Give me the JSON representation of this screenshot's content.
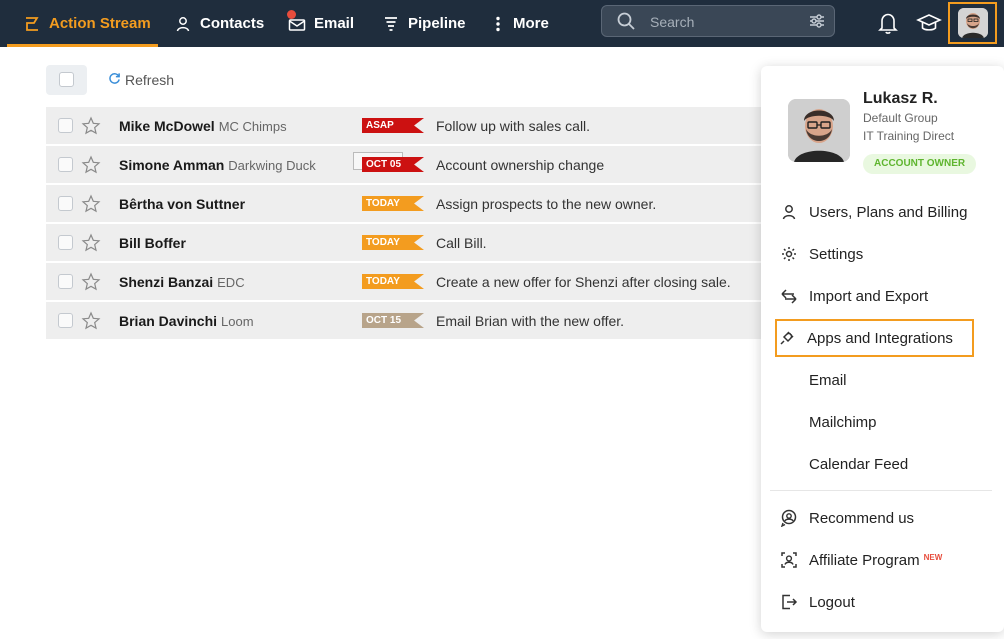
{
  "nav": {
    "items": [
      {
        "label": "Action Stream",
        "icon": "action-stream-icon",
        "active": true
      },
      {
        "label": "Contacts",
        "icon": "user-icon"
      },
      {
        "label": "Email",
        "icon": "envelope-icon"
      },
      {
        "label": "Pipeline",
        "icon": "pipeline-icon"
      },
      {
        "label": "More",
        "icon": "more-vertical-icon"
      }
    ],
    "search_placeholder": "Search"
  },
  "toolbar": {
    "refresh_label": "Refresh"
  },
  "tasks": [
    {
      "name": "Mike McDowel",
      "company": "MC Chimps",
      "badge": "ASAP",
      "badge_color": "#cc1111",
      "description": "Follow up with sales call."
    },
    {
      "name": "Simone Amman",
      "company": "Darkwing Duck",
      "badge": "OCT 05",
      "badge_color": "#cc1111",
      "description": "Account ownership change"
    },
    {
      "name": "Bêrtha von Suttner",
      "company": "",
      "badge": "TODAY",
      "badge_color": "#f39c1f",
      "description": "Assign prospects to the new owner."
    },
    {
      "name": "Bill Boffer",
      "company": "",
      "badge": "TODAY",
      "badge_color": "#f39c1f",
      "description": "Call Bill."
    },
    {
      "name": "Shenzi Banzai",
      "company": "EDC",
      "badge": "TODAY",
      "badge_color": "#f39c1f",
      "description": "Create a new offer for Shenzi after closing sale."
    },
    {
      "name": "Brian Davinchi",
      "company": "Loom",
      "badge": "OCT 15",
      "badge_color": "#b8a48a",
      "description": "Email Brian with the new offer."
    }
  ],
  "profile": {
    "name": "Lukasz R.",
    "group": "Default Group",
    "company": "IT Training Direct",
    "role_badge": "ACCOUNT OWNER"
  },
  "menu": {
    "users_plans_billing": "Users, Plans and Billing",
    "settings": "Settings",
    "import_export": "Import and Export",
    "apps_integrations": "Apps and Integrations",
    "email": "Email",
    "mailchimp": "Mailchimp",
    "calendar_feed": "Calendar Feed",
    "recommend": "Recommend us",
    "affiliate": "Affiliate Program",
    "affiliate_badge": "NEW",
    "logout": "Logout"
  },
  "colors": {
    "nav_bg": "#1f2d3d",
    "accent": "#f39c1f"
  }
}
